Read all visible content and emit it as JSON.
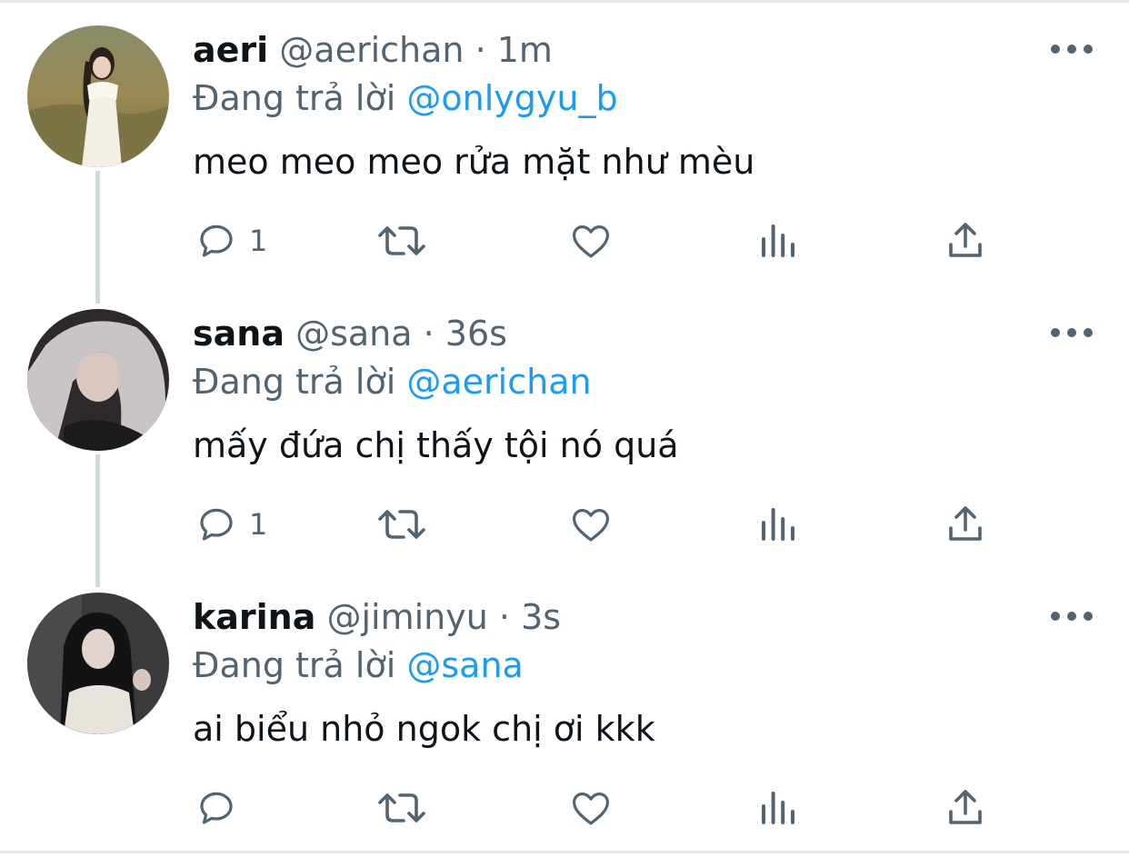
{
  "tweets": [
    {
      "display_name": "aeri",
      "handle": "@aerichan",
      "time": "· 1m",
      "reply_prefix": "Đang trả lời",
      "reply_to": "@onlygyu_b",
      "text": "meo meo meo rửa mặt như mèu",
      "reply_count": "1"
    },
    {
      "display_name": "sana",
      "handle": "@sana",
      "time": "· 36s",
      "reply_prefix": "Đang trả lời",
      "reply_to": "@aerichan",
      "text": "mấy đứa chị thấy tội nó quá",
      "reply_count": "1"
    },
    {
      "display_name": "karina",
      "handle": "@jiminyu",
      "time": "· 3s",
      "reply_prefix": "Đang trả lời",
      "reply_to": "@sana",
      "text": "ai biểu nhỏ ngok chị ơi kkk",
      "reply_count": ""
    }
  ],
  "icons": {
    "reply": "speech-bubble-icon",
    "retweet": "retweet-arrows-icon",
    "like": "heart-icon",
    "views": "bar-chart-icon",
    "share": "share-upload-icon",
    "more": "more-dots-icon"
  },
  "colors": {
    "text_primary": "#0f1419",
    "text_secondary": "#536471",
    "mention": "#1d9bf0",
    "thread_line": "#cfd9de"
  }
}
